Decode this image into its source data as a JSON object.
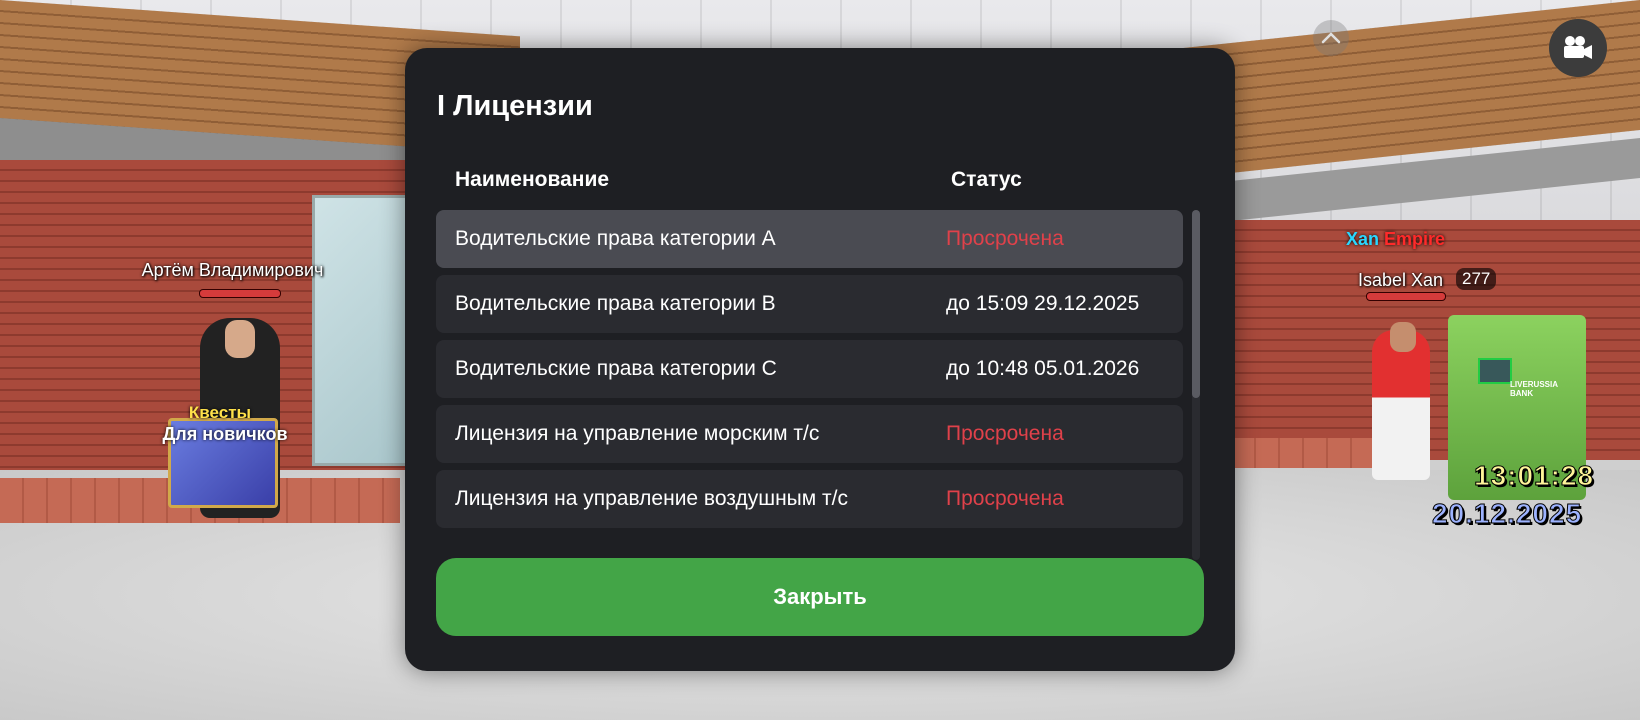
{
  "world": {
    "npc": {
      "name": "Артём Владимирович",
      "quest_title": "Квесты",
      "quest_subtitle": "Для новичков"
    },
    "player": {
      "gang_part1": "Xan",
      "gang_part2": "Empire",
      "name": "Isabel Xan",
      "id": "277"
    },
    "atm_label": "LIVERUSSIA BANK"
  },
  "hud": {
    "time": "13:01:28",
    "date": "20.12.2025",
    "camera_icon": "camera-icon",
    "collapse_icon": "chevron-up-icon"
  },
  "modal": {
    "title": "I Лицензии",
    "columns": {
      "name": "Наименование",
      "status": "Статус"
    },
    "rows": [
      {
        "name": "Водительские права категории A",
        "status": "Просрочена",
        "expired": true
      },
      {
        "name": "Водительские права категории B",
        "status": "до 15:09 29.12.2025",
        "expired": false
      },
      {
        "name": "Водительские права категории C",
        "status": "до 10:48 05.01.2026",
        "expired": false
      },
      {
        "name": "Лицензия на управление морским т/с",
        "status": "Просрочена",
        "expired": true
      },
      {
        "name": "Лицензия на управление воздушным т/с",
        "status": "Просрочена",
        "expired": true
      }
    ],
    "close_label": "Закрыть"
  },
  "colors": {
    "expired": "#e0414a",
    "close_button": "#43a547",
    "modal_bg": "#1e1f23"
  }
}
